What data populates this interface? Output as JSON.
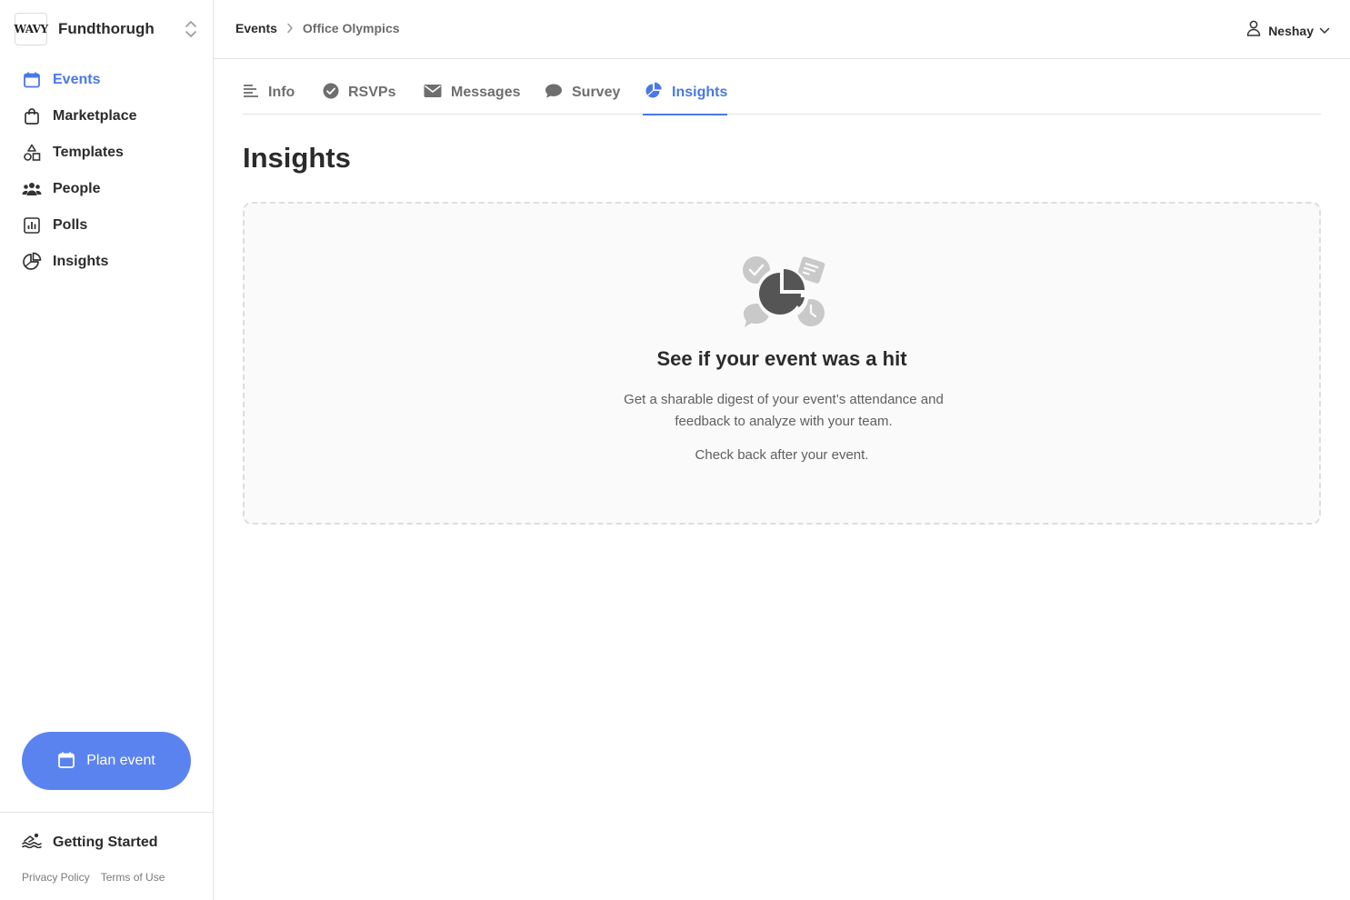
{
  "sidebar": {
    "logo_text": "WAVY",
    "org_name": "Fundthorugh",
    "items": [
      {
        "label": "Events",
        "icon": "calendar-icon",
        "active": true
      },
      {
        "label": "Marketplace",
        "icon": "shopping-bag-icon"
      },
      {
        "label": "Templates",
        "icon": "shapes-icon"
      },
      {
        "label": "People",
        "icon": "people-icon"
      },
      {
        "label": "Polls",
        "icon": "bar-chart-icon"
      },
      {
        "label": "Insights",
        "icon": "pie-chart-icon"
      }
    ],
    "plan_button": "Plan event",
    "getting_started": "Getting Started",
    "footer": {
      "privacy": "Privacy Policy",
      "terms": "Terms of Use"
    }
  },
  "header": {
    "breadcrumb": {
      "root": "Events",
      "current": "Office Olympics"
    },
    "user_name": "Neshay"
  },
  "tabs": [
    {
      "label": "Info",
      "icon": "lines-icon"
    },
    {
      "label": "RSVPs",
      "icon": "check-circle-icon"
    },
    {
      "label": "Messages",
      "icon": "envelope-icon"
    },
    {
      "label": "Survey",
      "icon": "chat-bubble-icon"
    },
    {
      "label": "Insights",
      "icon": "pie-chart-icon",
      "active": true
    }
  ],
  "main": {
    "title": "Insights",
    "empty_state": {
      "title": "See if your event was a hit",
      "body": "Get a sharable digest of your event’s attendance and feedback to analyze with your team.",
      "note": "Check back after your event."
    }
  },
  "colors": {
    "accent": "#4a78e8",
    "button": "#5b83f0",
    "text": "#2b2b2b",
    "muted": "#6e6e6e"
  }
}
